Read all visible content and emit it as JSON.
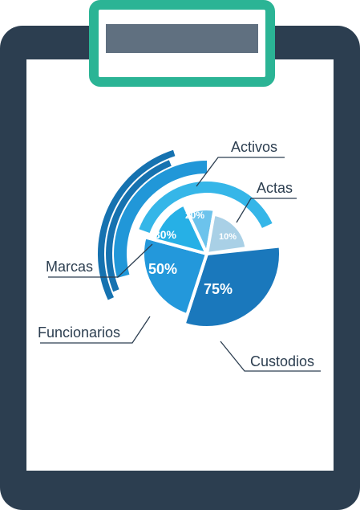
{
  "colors": {
    "board": "#2c3e50",
    "paper": "#ffffff",
    "clip_border": "#2bb495",
    "clip_fill": "#607080",
    "ring_dark": "#1672b0",
    "ring_mid": "#2197d8",
    "ring_light": "#35b6e8",
    "leader": "#2c3e50"
  },
  "chart_data": {
    "type": "pie",
    "categories": [
      "Custodios",
      "Funcionarios",
      "Marcas",
      "Activos",
      "Actas"
    ],
    "values": [
      75,
      50,
      30,
      20,
      10
    ],
    "value_labels": [
      "75%",
      "50%",
      "30%",
      "20%",
      "10%"
    ],
    "colors": [
      "#1a78bc",
      "#2398db",
      "#26b0e6",
      "#6cc3ec",
      "#a9d0e6"
    ]
  }
}
